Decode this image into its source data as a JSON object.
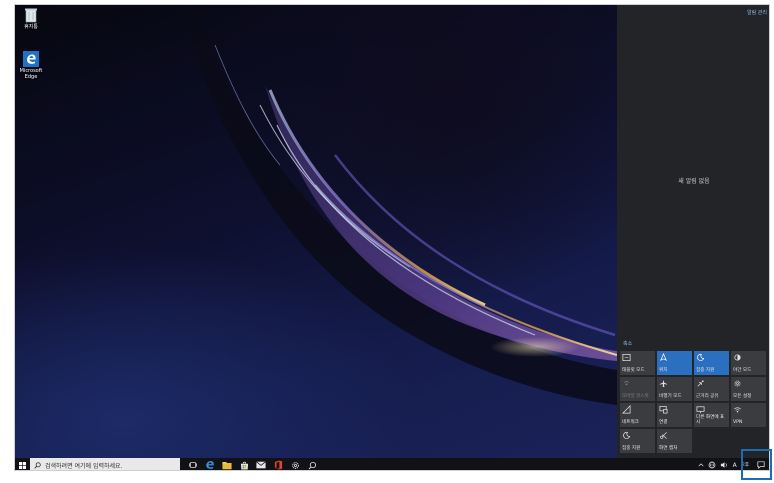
{
  "desktop": {
    "icons": [
      {
        "name": "recycle-bin",
        "label": "휴지통"
      },
      {
        "name": "edge-shortcut",
        "label": "Microsoft Edge"
      }
    ]
  },
  "action_center": {
    "manage_notifications": "알림 관리",
    "no_notifications": "새 알림 없음",
    "collapse": "축소",
    "quick_actions": [
      {
        "label": "태블릿 모드",
        "icon": "tablet-mode-icon",
        "state": "off"
      },
      {
        "label": "위치",
        "icon": "location-icon",
        "state": "on"
      },
      {
        "label": "집중 지원",
        "icon": "focus-assist-icon",
        "state": "on"
      },
      {
        "label": "야간 모드",
        "icon": "night-light-icon",
        "state": "off"
      },
      {
        "label": "모바일 핫스팟",
        "icon": "mobile-hotspot-icon",
        "state": "disabled"
      },
      {
        "label": "비행기 모드",
        "icon": "airplane-mode-icon",
        "state": "off"
      },
      {
        "label": "근거리 공유",
        "icon": "nearby-sharing-icon",
        "state": "off"
      },
      {
        "label": "모든 설정",
        "icon": "settings-icon",
        "state": "off"
      },
      {
        "label": "네트워크",
        "icon": "network-icon",
        "state": "off"
      },
      {
        "label": "연결",
        "icon": "connect-icon",
        "state": "off"
      },
      {
        "label": "다른 화면에 표시",
        "icon": "project-icon",
        "state": "off"
      },
      {
        "label": "VPN",
        "icon": "vpn-icon",
        "state": "off"
      },
      {
        "label": "집중 지원",
        "icon": "moon-icon",
        "state": "off"
      },
      {
        "label": "화면 캡처",
        "icon": "screen-snip-icon",
        "state": "off"
      }
    ]
  },
  "taskbar": {
    "search_placeholder": "검색하려면 여기에 입력하세요.",
    "apps": [
      {
        "name": "task-view-icon"
      },
      {
        "name": "edge-icon"
      },
      {
        "name": "file-explorer-icon"
      },
      {
        "name": "store-icon"
      },
      {
        "name": "mail-icon"
      },
      {
        "name": "office-icon"
      },
      {
        "name": "settings-icon"
      },
      {
        "name": "cortana-icon"
      }
    ],
    "tray": {
      "language": "A",
      "clock_time": "오후",
      "clock_date": ""
    }
  },
  "colors": {
    "accent": "#2a6fc0",
    "highlight": "#1a6cb7",
    "panel": "#232428",
    "taskbar": "#101216"
  }
}
